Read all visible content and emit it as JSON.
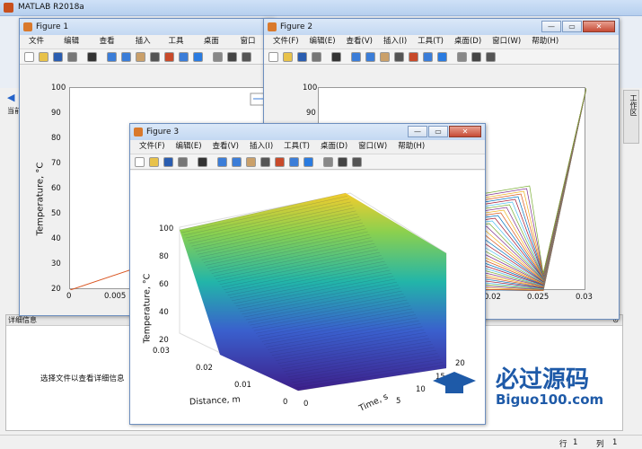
{
  "app": {
    "title": "MATLAB R2018a",
    "side_label": "当前",
    "detail_label": "详细信息",
    "detail_hint": "选择文件以查看详细信息",
    "right_tab": "工作区",
    "status_row": "行",
    "status_row_val": "1",
    "status_col": "列",
    "status_col_val": "1"
  },
  "menus": [
    "文件(F)",
    "编辑(E)",
    "查看(V)",
    "插入(I)",
    "工具(T)",
    "桌面(D)",
    "窗口(W)",
    "帮助(H)"
  ],
  "fig1": {
    "title": "Figure 1",
    "ylabel": "Temperature, °C",
    "yticks": [
      "100",
      "90",
      "80",
      "70",
      "60",
      "50",
      "40",
      "30",
      "20"
    ],
    "xticks": [
      "0",
      "0.005"
    ]
  },
  "fig2": {
    "title": "Figure 2",
    "yticks": [
      "100",
      "90"
    ],
    "xticks": [
      "0.02",
      "0.025",
      "0.03"
    ]
  },
  "fig3": {
    "title": "Figure 3",
    "zlabel": "Temperature, °C",
    "xlabel": "Distance, m",
    "ylabel": "Time, s",
    "zticks": [
      "100",
      "80",
      "60",
      "40",
      "20"
    ],
    "dist_ticks": [
      "0.03",
      "0.02",
      "0.01",
      "0"
    ],
    "time_ticks": [
      "20",
      "15",
      "10",
      "5",
      "0"
    ]
  },
  "watermark": {
    "name": "必过源码",
    "url": "Biguo100.com"
  },
  "chart_data": [
    {
      "type": "line",
      "title": "",
      "xlabel": "",
      "ylabel": "Temperature, °C",
      "xlim": [
        0,
        0.005
      ],
      "ylim": [
        20,
        100
      ],
      "series": [
        {
          "x": [
            0,
            0.005
          ],
          "y": [
            20,
            40
          ]
        }
      ]
    },
    {
      "type": "line",
      "title": "",
      "xlabel": "",
      "ylabel": "",
      "xlim": [
        0.015,
        0.03
      ],
      "ylim": [
        20,
        100
      ],
      "series_count": 40
    },
    {
      "type": "surface",
      "title": "",
      "xlabel": "Distance, m",
      "ylabel": "Time, s",
      "zlabel": "Temperature, °C",
      "xlim": [
        0,
        0.03
      ],
      "ylim": [
        0,
        20
      ],
      "zlim": [
        20,
        100
      ]
    }
  ]
}
